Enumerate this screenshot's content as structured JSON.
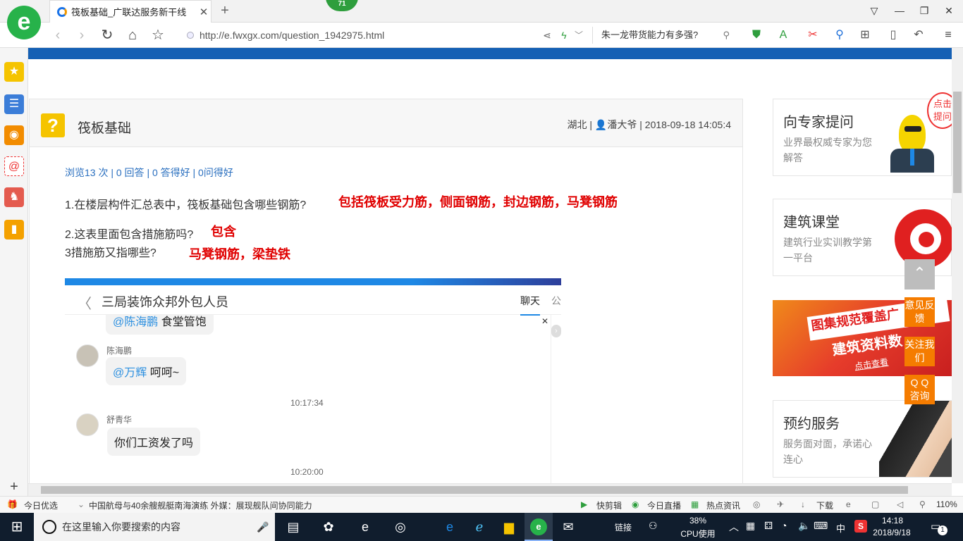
{
  "browser": {
    "tab_title": "筏板基础_广联达服务新干线",
    "badge_count": "71",
    "url": "http://e.fwxgx.com/question_1942975.html",
    "search_text": "朱一龙带货能力有多强?"
  },
  "question": {
    "title": "筏板基础",
    "region": "湖北",
    "author": "潘大爷",
    "datetime": "2018-09-18 14:05:4",
    "stats": "浏览13 次 | 0 回答 | 0 答得好 | 0问得好",
    "q1": "1.在楼层构件汇总表中，筏板基础包含哪些钢筋?",
    "a1": "包括筏板受力筋，侧面钢筋，封边钢筋，马凳钢筋",
    "q2": "2.这表里面包含措施筋吗?",
    "a2": "包含",
    "q3": "3措施筋又指哪些?",
    "a3": "马凳钢筋，梁垫铁"
  },
  "chat": {
    "group_name": "三局装饰众邦外包人员",
    "tab_chat": "聊天",
    "tab_other": "公",
    "msg0_at": "@陈海鹏",
    "msg0_text": "食堂管饱",
    "msg1_user": "陈海鹏",
    "msg1_at": "@万辉",
    "msg1_text": "呵呵~",
    "time1": "10:17:34",
    "msg2_user": "舒青华",
    "msg2_text": "你们工资发了吗",
    "time2": "10:20:00"
  },
  "right": {
    "card1_title": "向专家提问",
    "card1_desc": "业界最权威专家为您解答",
    "card1_bubble": "点击提问",
    "card2_title": "建筑课堂",
    "card2_desc": "建筑行业实训教学第一平台",
    "banner_line1": "图集规范覆盖广",
    "banner_line2": "建筑资料数",
    "banner_link": "点击查看",
    "card4_title": "预约服务",
    "card4_desc": "服务面对面，承诺心连心"
  },
  "floating": {
    "feedback": "意见反馈",
    "follow": "关注我们",
    "qq": "Q Q 咨询"
  },
  "statusbar": {
    "today": "今日优选",
    "news": "中国航母与40余艘舰艇南海演练 外媒：展现舰队间协同能力",
    "clip": "快剪辑",
    "live": "今日直播",
    "hot": "热点资讯",
    "download": "下载",
    "zoom": "110%"
  },
  "taskbar": {
    "search_placeholder": "在这里输入你要搜索的内容",
    "link_label": "链接",
    "cpu_percent": "38%",
    "cpu_label": "CPU使用",
    "ime": "中",
    "time": "14:18",
    "date": "2018/9/18",
    "notifications": "1"
  }
}
